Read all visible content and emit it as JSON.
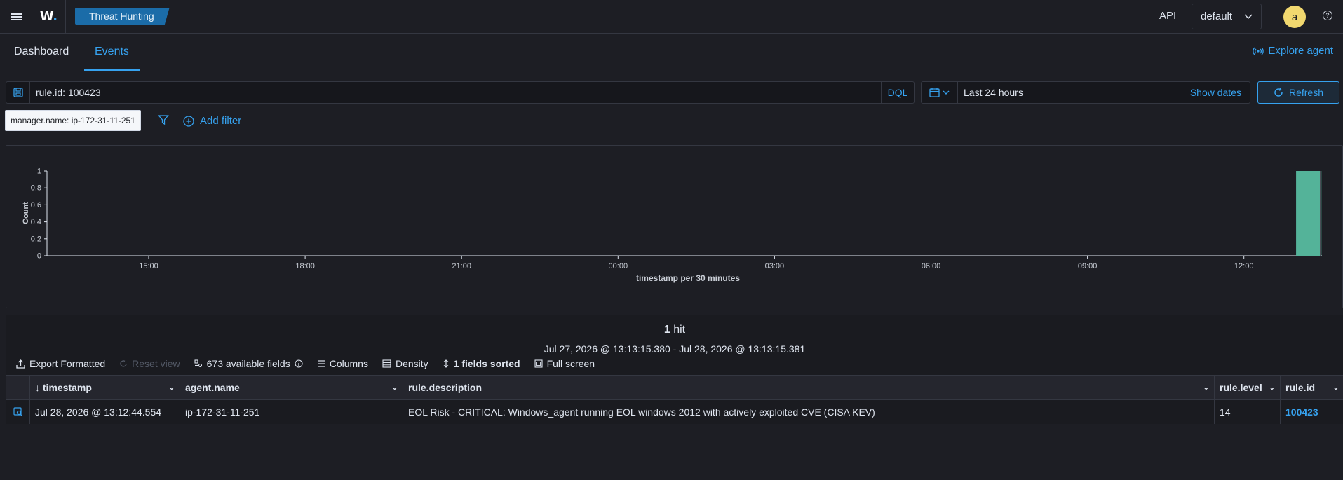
{
  "header": {
    "logo_text": "W",
    "logo_dot": ".",
    "app_badge": "Threat Hunting",
    "api_label": "API",
    "space_selected": "default",
    "avatar_letter": "a",
    "help_glyph": "?"
  },
  "tabs": {
    "dashboard": "Dashboard",
    "events": "Events",
    "explore_agent": "Explore agent"
  },
  "query": {
    "value": "rule.id: 100423",
    "language": "DQL"
  },
  "datepicker": {
    "range": "Last 24 hours",
    "show_dates": "Show dates",
    "refresh": "Refresh"
  },
  "filters": {
    "pill": "manager.name: ip-172-31-11-251",
    "add_filter": "Add filter"
  },
  "chart_data": {
    "type": "bar",
    "ylabel": "Count",
    "xlabel": "timestamp per 30 minutes",
    "ylim": [
      0,
      1
    ],
    "y_ticks": [
      "0",
      "0.2",
      "0.4",
      "0.6",
      "0.8",
      "1"
    ],
    "x_ticks": [
      "15:00",
      "18:00",
      "21:00",
      "00:00",
      "03:00",
      "06:00",
      "09:00",
      "12:00"
    ],
    "bars": [
      {
        "x": "13:00",
        "value": 1
      }
    ],
    "bar_color": "#54b399"
  },
  "results": {
    "hits_count": "1",
    "hits_label": "hit",
    "range": "Jul 27, 2026 @ 13:13:15.380 - Jul 28, 2026 @ 13:13:15.381",
    "toolbar": {
      "export": "Export Formatted",
      "reset": "Reset view",
      "fields": "673 available fields",
      "columns": "Columns",
      "density": "Density",
      "sorted": "1 fields sorted",
      "fullscreen": "Full screen"
    },
    "columns": [
      "timestamp",
      "agent.name",
      "rule.description",
      "rule.level",
      "rule.id"
    ],
    "rows": [
      {
        "timestamp": "Jul 28, 2026 @ 13:12:44.554",
        "agent_name": "ip-172-31-11-251",
        "rule_description": "EOL Risk - CRITICAL: Windows_agent running EOL windows 2012 with actively exploited CVE (CISA KEV)",
        "rule_level": "14",
        "rule_id": "100423"
      }
    ]
  }
}
